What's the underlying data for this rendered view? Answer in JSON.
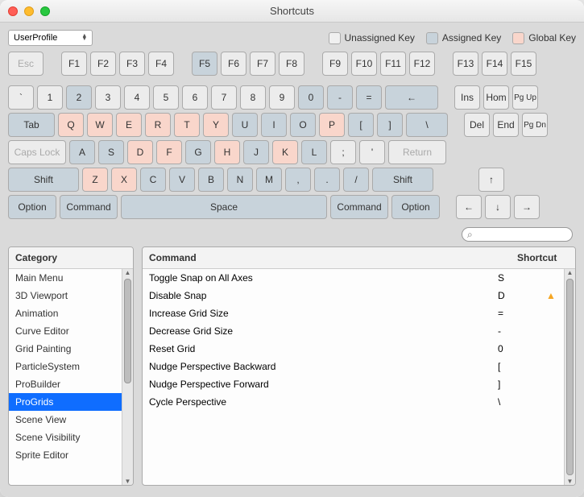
{
  "window_title": "Shortcuts",
  "profile_dropdown": {
    "label": "UserProfile"
  },
  "legend": {
    "unassigned": "Unassigned Key",
    "assigned": "Assigned Key",
    "global": "Global Key"
  },
  "keys": {
    "esc": "Esc",
    "f1": "F1",
    "f2": "F2",
    "f3": "F3",
    "f4": "F4",
    "f5": "F5",
    "f6": "F6",
    "f7": "F7",
    "f8": "F8",
    "f9": "F9",
    "f10": "F10",
    "f11": "F11",
    "f12": "F12",
    "f13": "F13",
    "f14": "F14",
    "f15": "F15",
    "grave": "`",
    "n1": "1",
    "n2": "2",
    "n3": "3",
    "n4": "4",
    "n5": "5",
    "n6": "6",
    "n7": "7",
    "n8": "8",
    "n9": "9",
    "n0": "0",
    "minus": "-",
    "equal": "=",
    "back": "←",
    "tab": "Tab",
    "q": "Q",
    "w": "W",
    "e": "E",
    "r": "R",
    "t": "T",
    "y": "Y",
    "u": "U",
    "i": "I",
    "o": "O",
    "p": "P",
    "lb": "[",
    "rb": "]",
    "bslash": "\\",
    "caps": "Caps Lock",
    "a": "A",
    "s": "S",
    "d": "D",
    "f": "F",
    "g": "G",
    "h": "H",
    "j": "J",
    "k": "K",
    "l": "L",
    "semi": ";",
    "apos": "'",
    "return": "Return",
    "lshift": "Shift",
    "z": "Z",
    "x": "X",
    "c": "C",
    "v": "V",
    "b": "B",
    "n": "N",
    "m": "M",
    "comma": ",",
    "period": ".",
    "slash": "/",
    "rshift": "Shift",
    "lopt": "Option",
    "lcmd": "Command",
    "space": "Space",
    "rcmd": "Command",
    "ropt": "Option",
    "ins": "Ins",
    "hom": "Hom",
    "pgup": "Pg Up",
    "del": "Del",
    "end": "End",
    "pgdn": "Pg Dn",
    "up": "↑",
    "left": "←",
    "down": "↓",
    "right": "→"
  },
  "categories": {
    "header": "Category",
    "items": [
      "Main Menu",
      "3D Viewport",
      "Animation",
      "Curve Editor",
      "Grid Painting",
      "ParticleSystem",
      "ProBuilder",
      "ProGrids",
      "Scene View",
      "Scene Visibility",
      "Sprite Editor"
    ],
    "selected_index": 7
  },
  "commands": {
    "header_command": "Command",
    "header_shortcut": "Shortcut",
    "rows": [
      {
        "name": "Toggle Snap on All Axes",
        "shortcut": "S",
        "warn": false
      },
      {
        "name": "Disable Snap",
        "shortcut": "D",
        "warn": true
      },
      {
        "name": "Increase Grid Size",
        "shortcut": "=",
        "warn": false
      },
      {
        "name": "Decrease Grid Size",
        "shortcut": "-",
        "warn": false
      },
      {
        "name": "Reset Grid",
        "shortcut": "0",
        "warn": false
      },
      {
        "name": "Nudge Perspective Backward",
        "shortcut": "[",
        "warn": false
      },
      {
        "name": "Nudge Perspective Forward",
        "shortcut": "]",
        "warn": false
      },
      {
        "name": "Cycle Perspective",
        "shortcut": "\\",
        "warn": false
      }
    ]
  },
  "search_placeholder": ""
}
